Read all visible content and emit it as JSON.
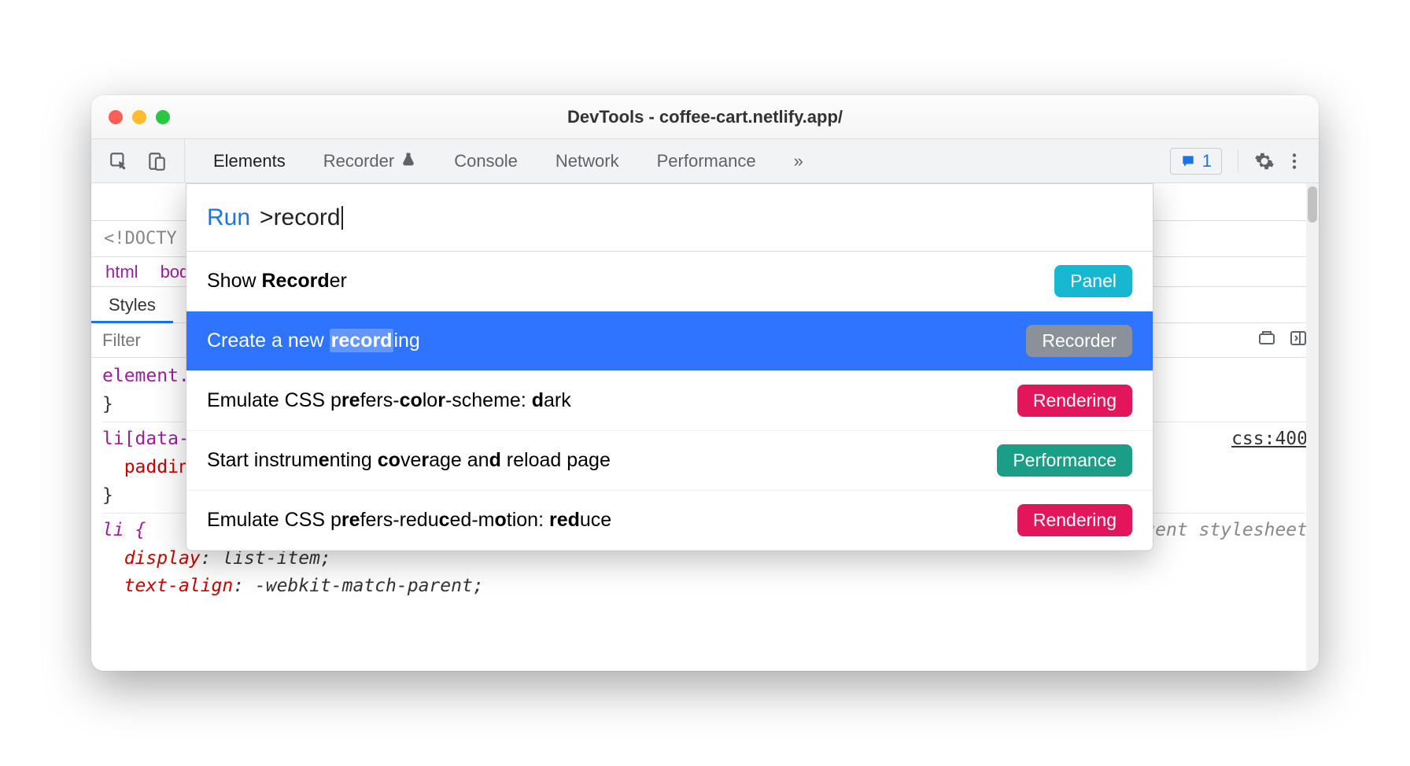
{
  "window": {
    "title": "DevTools - coffee-cart.netlify.app/"
  },
  "toolbar": {
    "tabs": [
      "Elements",
      "Recorder",
      "Console",
      "Network",
      "Performance"
    ],
    "active_tab": "Elements",
    "issue_count": "1",
    "more_glyph": "»"
  },
  "background": {
    "doctype": "<!DOCTY",
    "breadcrumb": [
      "html",
      "bod"
    ],
    "styles_tab": "Styles",
    "filter_placeholder": "Filter",
    "rules": {
      "r1_sel": "element.s",
      "r1_close": "}",
      "r2_sel": "li[data-v",
      "r2_prop": "paddin",
      "r2_close": "}",
      "r2_link": "css:400",
      "r3_sel": "li {",
      "r3_comment": "user agent stylesheet",
      "r3_p1_name": "display",
      "r3_p1_val": ": list-item;",
      "r3_p2_name": "text-align",
      "r3_p2_val": ": -webkit-match-parent;"
    }
  },
  "palette": {
    "prefix": "Run",
    "query": ">record",
    "items": [
      {
        "label_pre": "Show ",
        "label_bold": "Record",
        "label_post": "er",
        "badge": "Panel",
        "badge_class": "panel",
        "selected": false
      },
      {
        "label_pre": "Create a new ",
        "label_hl_bold": "record",
        "label_post": "ing",
        "badge": "Recorder",
        "badge_class": "recorder-b",
        "selected": true
      },
      {
        "raw_html": "Emulate CSS p<b>re</b>fers-<b>co</b>lo<b>r</b>-scheme: <b>d</b>ark",
        "badge": "Rendering",
        "badge_class": "rendering",
        "selected": false
      },
      {
        "raw_html": "Start instrum<b>e</b>nting <b>co</b>ve<b>r</b>age an<b>d</b> reload page",
        "badge": "Performance",
        "badge_class": "performance",
        "selected": false
      },
      {
        "raw_html": "Emulate CSS p<b>re</b>fers-redu<b>c</b>ed-m<b>o</b>tion: <b>red</b>uce",
        "badge": "Rendering",
        "badge_class": "rendering",
        "selected": false
      }
    ]
  }
}
